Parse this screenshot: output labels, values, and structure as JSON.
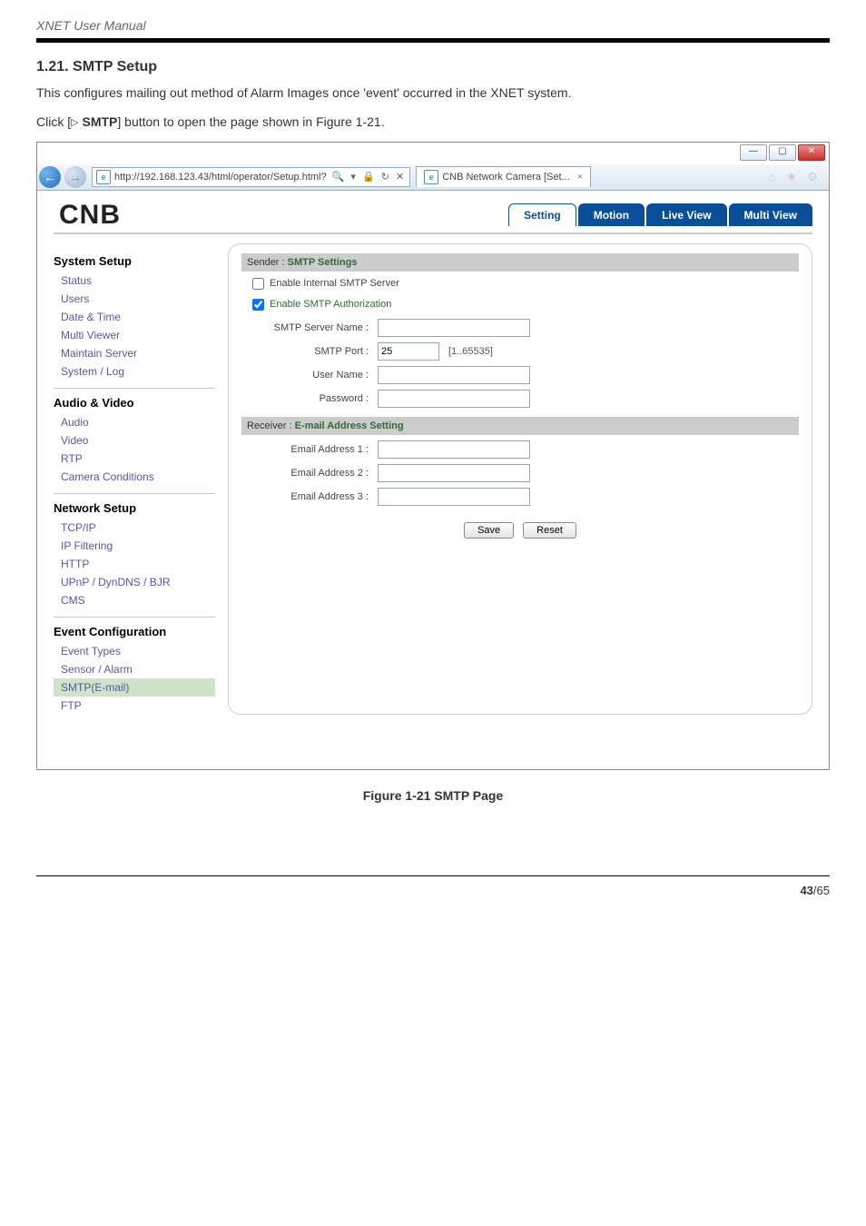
{
  "doc": {
    "manual_title": "XNET User Manual",
    "section_no": "1.21. SMTP Setup",
    "intro": "This configures mailing out method of Alarm Images once 'event' occurred in the XNET system.",
    "click_prefix": "Click [",
    "click_glyph": "▷",
    "click_bold": " SMTP",
    "click_suffix": "] button to open the page shown in Figure 1-21.",
    "figure_caption": "Figure 1-21 SMTP Page",
    "page_current": "43",
    "page_sep": " / ",
    "page_total": "65"
  },
  "win": {
    "min": "—",
    "max": "▢",
    "close": "✕"
  },
  "ie": {
    "url": "http://192.168.123.43/html/operator/Setup.html?",
    "url_glyphs": "🔍 ▾  🔒 ↻ ✕",
    "tab_title": "CNB Network Camera [Set...",
    "tab_close": "×",
    "right_icons": "⌂ ★ ⚙"
  },
  "brand": "CNB",
  "top_tabs": {
    "setting": "Setting",
    "motion": "Motion",
    "live": "Live View",
    "multi": "Multi View"
  },
  "side": {
    "g1": "System Setup",
    "g1_items": [
      "Status",
      "Users",
      "Date & Time",
      "Multi Viewer",
      "Maintain Server",
      "System / Log"
    ],
    "g2": "Audio & Video",
    "g2_items": [
      "Audio",
      "Video",
      "RTP",
      "Camera Conditions"
    ],
    "g3": "Network Setup",
    "g3_items": [
      "TCP/IP",
      "IP Filtering",
      "HTTP",
      "UPnP / DynDNS / BJR",
      "CMS"
    ],
    "g4": "Event Configuration",
    "g4_items": [
      "Event Types",
      "Sensor / Alarm",
      "SMTP(E-mail)",
      "FTP"
    ]
  },
  "form": {
    "sender_prefix": "Sender : ",
    "sender_bold": "SMTP Settings",
    "chk_internal": "Enable Internal SMTP Server",
    "chk_auth": "Enable SMTP Authorization",
    "lbl_server": "SMTP Server Name :",
    "lbl_port": "SMTP Port :",
    "val_port": "25",
    "hint_port": "[1..65535]",
    "lbl_user": "User Name :",
    "lbl_pass": "Password :",
    "receiver_prefix": "Receiver : ",
    "receiver_bold": "E-mail Address Setting",
    "lbl_e1": "Email Address 1 :",
    "lbl_e2": "Email Address 2 :",
    "lbl_e3": "Email Address 3 :",
    "btn_save": "Save",
    "btn_reset": "Reset"
  }
}
